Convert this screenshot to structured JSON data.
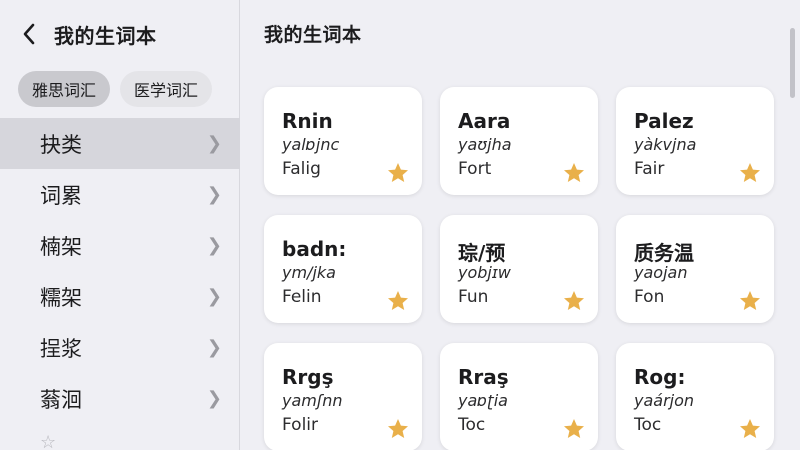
{
  "sidebar": {
    "title": "我的生词本",
    "chips": [
      "雅思词汇",
      "医学词汇"
    ],
    "categories": [
      "抉类",
      "词累",
      "楠架",
      "糯架",
      "挰浆",
      "蓊洄"
    ]
  },
  "main": {
    "title": "我的生词本",
    "cards": [
      {
        "word": "Rnin",
        "phonetic": "yalɒjnc",
        "translation": "Falig"
      },
      {
        "word": "Aara",
        "phonetic": "yaʊjha",
        "translation": "Fort"
      },
      {
        "word": "Palez",
        "phonetic": "yàkvjna",
        "translation": "Fair"
      },
      {
        "word": "badn:",
        "phonetic": "ym/jka",
        "translation": "Felin"
      },
      {
        "word": "琮/预",
        "phonetic": "yobjɪw",
        "translation": "Fun"
      },
      {
        "word": "质务温",
        "phonetic": "yaojan",
        "translation": "Fon"
      },
      {
        "word": "Rrgş",
        "phonetic": "yamʃnn",
        "translation": "Folir"
      },
      {
        "word": "Rraş",
        "phonetic": "yaɒʈia",
        "translation": "Toc"
      },
      {
        "word": "Rog:",
        "phonetic": "yaárjon",
        "translation": "Toc"
      }
    ]
  },
  "colors": {
    "star": "#e9b04a",
    "background": "#efeff4",
    "card": "#ffffff",
    "active_row": "#d6d6dc"
  },
  "icons": {
    "back": "chevron-left-icon",
    "row_arrow": "chevron-right-icon",
    "favorite": "star-icon"
  }
}
